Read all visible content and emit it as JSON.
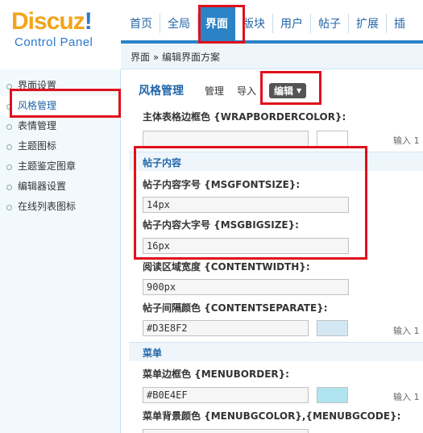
{
  "logo": {
    "brand": "Discuz",
    "mark": "!",
    "subtitle": "Control Panel"
  },
  "topnav": [
    {
      "label": "首页"
    },
    {
      "label": "全局"
    },
    {
      "label": "界面"
    },
    {
      "label": "版块"
    },
    {
      "label": "用户"
    },
    {
      "label": "帖子"
    },
    {
      "label": "扩展"
    },
    {
      "label": "插"
    }
  ],
  "breadcrumb": "界面 » 编辑界面方案",
  "sidebar": [
    {
      "label": "界面设置"
    },
    {
      "label": "风格管理"
    },
    {
      "label": "表情管理"
    },
    {
      "label": "主题图标"
    },
    {
      "label": "主题鉴定图章"
    },
    {
      "label": "编辑器设置"
    },
    {
      "label": "在线列表图标"
    }
  ],
  "main": {
    "title": "风格管理",
    "tabs": [
      "管理",
      "导入",
      "编辑"
    ],
    "fields": {
      "wrapborder_label": "主体表格边框色 {WRAPBORDERCOLOR}:",
      "wrapborder_value": "",
      "section_post": "帖子内容",
      "msgfontsize_label": "帖子内容字号 {MSGFONTSIZE}:",
      "msgfontsize_value": "14px",
      "msgbigsize_label": "帖子内容大字号 {MSGBIGSIZE}:",
      "msgbigsize_value": "16px",
      "contentwidth_label": "阅读区域宽度 {CONTENTWIDTH}:",
      "contentwidth_value": "900px",
      "contentsep_label": "帖子间隔颜色 {CONTENTSEPARATE}:",
      "contentsep_value": "#D3E8F2",
      "section_menu": "菜单",
      "menuborder_label": "菜单边框色 {MENUBORDER}:",
      "menuborder_value": "#B0E4EF",
      "menubg_label": "菜单背景颜色 {MENUBGCOLOR},{MENUBGCODE}:"
    },
    "hint": "输入 1"
  },
  "colors": {
    "accent": "#2B83C6",
    "highlight": "#E0101C",
    "contentsep_swatch": "#D3E8F2",
    "menuborder_swatch": "#B0E4EF"
  }
}
